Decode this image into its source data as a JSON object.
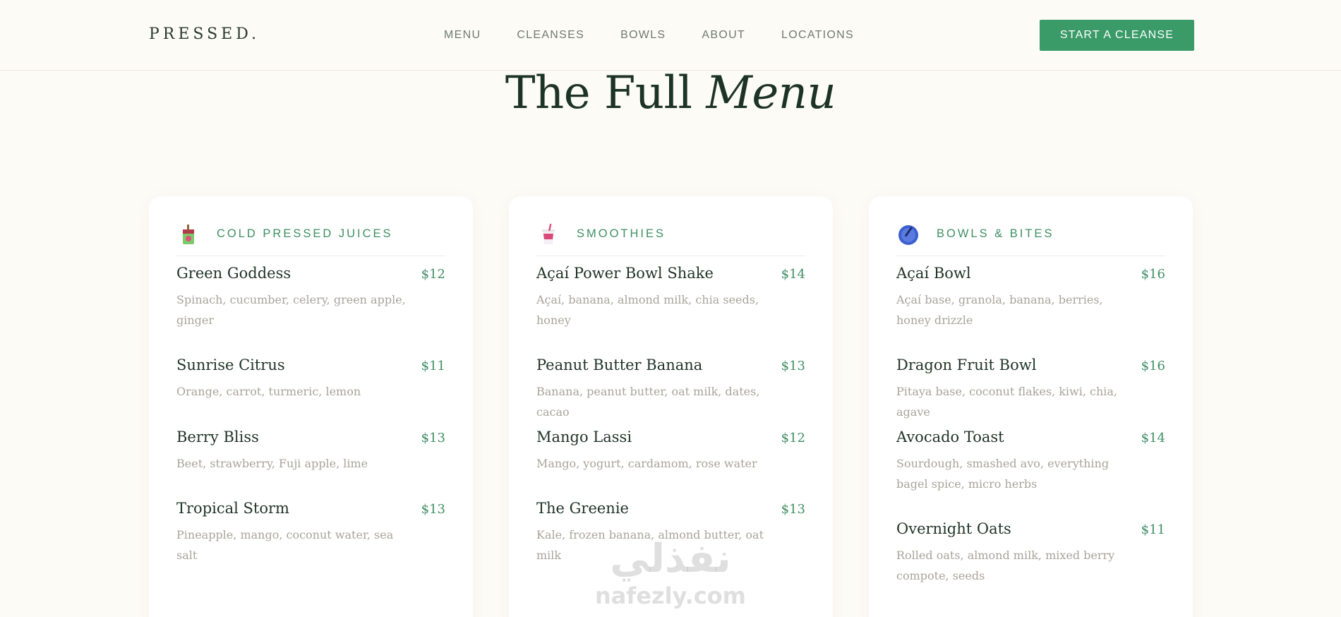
{
  "header": {
    "logo": "PRESSED.",
    "nav": [
      "MENU",
      "CLEANSES",
      "BOWLS",
      "ABOUT",
      "LOCATIONS"
    ],
    "cta": "START A CLEANSE"
  },
  "page": {
    "title_plain": "The Full",
    "title_italic": "Menu"
  },
  "categories": [
    {
      "label": "COLD PRESSED JUICES",
      "icon": "juice-box-icon",
      "items": [
        {
          "name": "Green Goddess",
          "price": "$12",
          "desc": "Spinach, cucumber, celery, green apple, ginger"
        },
        {
          "name": "Sunrise Citrus",
          "price": "$11",
          "desc": "Orange, carrot, turmeric, lemon"
        },
        {
          "name": "Berry Bliss",
          "price": "$13",
          "desc": "Beet, strawberry, Fuji apple, lime"
        },
        {
          "name": "Tropical Storm",
          "price": "$13",
          "desc": "Pineapple, mango, coconut water, sea salt"
        }
      ]
    },
    {
      "label": "SMOOTHIES",
      "icon": "smoothie-cup-icon",
      "items": [
        {
          "name": "Açaí Power Bowl Shake",
          "price": "$14",
          "desc": "Açaí, banana, almond milk, chia seeds, honey"
        },
        {
          "name": "Peanut Butter Banana",
          "price": "$13",
          "desc": "Banana, peanut butter, oat milk, dates, cacao"
        },
        {
          "name": "Mango Lassi",
          "price": "$12",
          "desc": "Mango, yogurt, cardamom, rose water"
        },
        {
          "name": "The Greenie",
          "price": "$13",
          "desc": "Kale, frozen banana, almond butter, oat milk"
        }
      ]
    },
    {
      "label": "BOWLS & BITES",
      "icon": "bowl-spoon-icon",
      "items": [
        {
          "name": "Açaí Bowl",
          "price": "$16",
          "desc": "Açaí base, granola, banana, berries, honey drizzle"
        },
        {
          "name": "Dragon Fruit Bowl",
          "price": "$16",
          "desc": "Pitaya base, coconut flakes, kiwi, chia, agave"
        },
        {
          "name": "Avocado Toast",
          "price": "$14",
          "desc": "Sourdough, smashed avo, everything bagel spice, micro herbs"
        },
        {
          "name": "Overnight Oats",
          "price": "$11",
          "desc": "Rolled oats, almond milk, mixed berry compote, seeds"
        }
      ]
    }
  ],
  "watermark": {
    "arabic": "نفذلي",
    "latin": "nafezly.com"
  },
  "colors": {
    "background": "#fdfbf6",
    "accent": "#3a9a68",
    "heading": "#1d3326",
    "muted": "#a8a49a"
  }
}
